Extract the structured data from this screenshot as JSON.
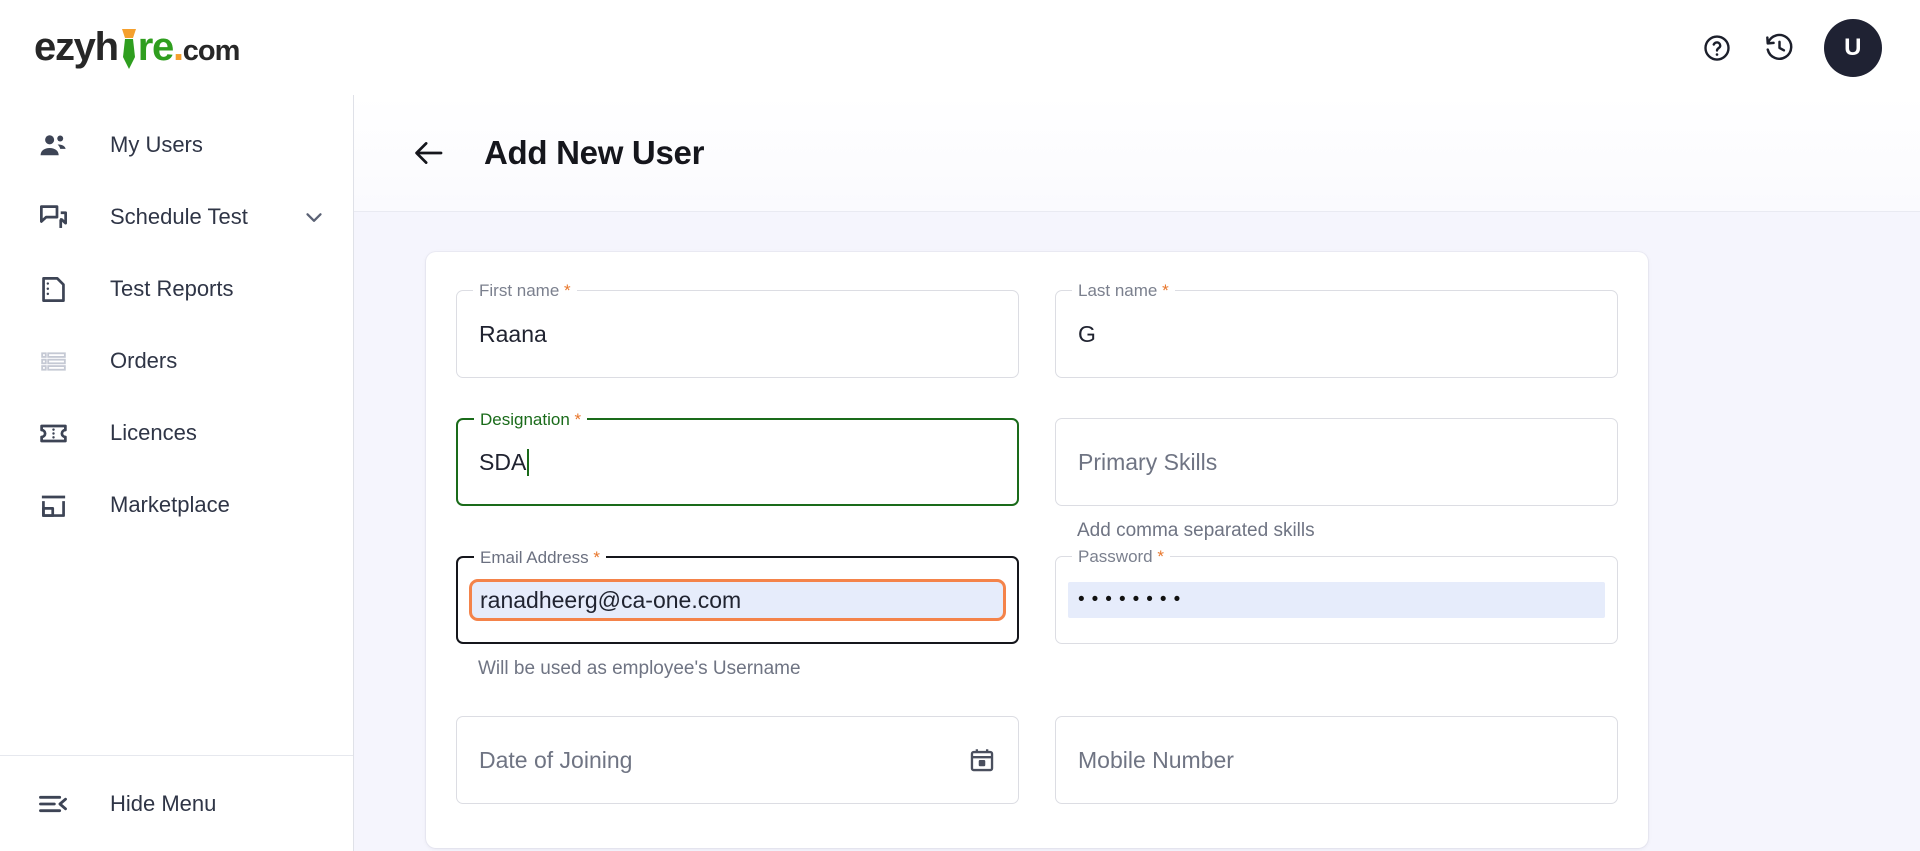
{
  "brand": {
    "name_part1": "ezyh",
    "name_part2": "re",
    "dot": ".",
    "suffix": "com",
    "green_hex": "#2f9e1f",
    "orange_hex": "#f5a02d",
    "dark_hex": "#272727"
  },
  "topbar": {
    "help_icon": "help-circle-icon",
    "history_icon": "history-icon",
    "avatar_initial": "U"
  },
  "sidebar": {
    "items": [
      {
        "label": "My Users",
        "icon": "people-icon",
        "has_chevron": false,
        "muted": false
      },
      {
        "label": "Schedule Test",
        "icon": "forum-chat-icon",
        "has_chevron": true,
        "muted": false
      },
      {
        "label": "Test Reports",
        "icon": "document-report-icon",
        "has_chevron": false,
        "muted": false
      },
      {
        "label": "Orders",
        "icon": "list-view-icon",
        "has_chevron": false,
        "muted": true
      },
      {
        "label": "Licences",
        "icon": "ticket-icon",
        "has_chevron": false,
        "muted": false
      },
      {
        "label": "Marketplace",
        "icon": "storefront-icon",
        "has_chevron": false,
        "muted": false
      }
    ],
    "footer": {
      "label": "Hide Menu",
      "icon": "menu-collapse-icon"
    }
  },
  "page": {
    "title": "Add New User",
    "back_icon": "arrow-left-icon"
  },
  "form": {
    "first_name": {
      "label": "First name",
      "required_mark": "*",
      "value": "Raana",
      "state": "filled"
    },
    "last_name": {
      "label": "Last name",
      "required_mark": "*",
      "value": "G",
      "state": "filled"
    },
    "designation": {
      "label": "Designation",
      "required_mark": "*",
      "value": "SDA",
      "state": "focused",
      "focus_color": "#1a6b1a"
    },
    "primary_skills": {
      "label": "Primary Skills",
      "placeholder": "Primary Skills",
      "value": "",
      "helper": "Add comma separated skills",
      "state": "empty"
    },
    "email": {
      "label": "Email Address",
      "required_mark": "*",
      "value": "ranadheerg@ca-one.com",
      "helper": "Will be used as employee's Username",
      "state": "hovered-autofill",
      "suggestion_ring_color": "#f4834a",
      "autofill_bg": "#e6ecfb"
    },
    "password": {
      "label": "Password",
      "required_mark": "*",
      "value": "••••••••",
      "state": "autofilled",
      "autofill_bg": "#e6ecfb"
    },
    "date_of_joining": {
      "label": "Date of Joining",
      "placeholder": "Date of Joining",
      "value": "",
      "icon": "calendar-icon",
      "state": "empty"
    },
    "mobile_number": {
      "label": "Mobile Number",
      "placeholder": "Mobile Number",
      "value": "",
      "state": "empty"
    }
  }
}
